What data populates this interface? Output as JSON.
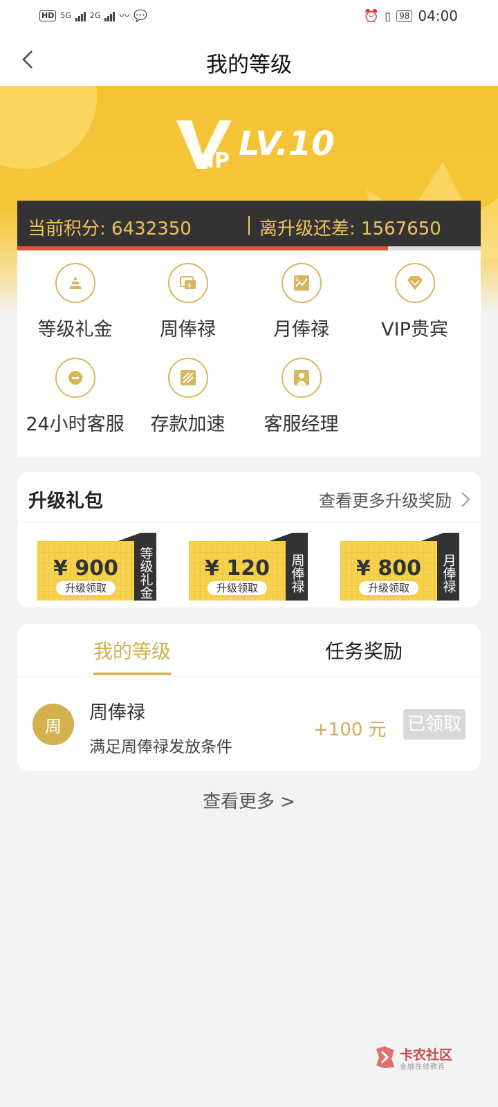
{
  "status_bar": {
    "network_hd": "HD",
    "net1": "5G",
    "net2": "2G",
    "battery": "98",
    "time": "04:00"
  },
  "header": {
    "title": "我的等级"
  },
  "hero": {
    "level": "LV.10",
    "points_label": "当前积分: 6432350",
    "gap_label": "离升级还差: 1567650",
    "progress": 0.8
  },
  "privileges": [
    {
      "label": "等级礼金",
      "icon": "pyramid-icon"
    },
    {
      "label": "周俸禄",
      "icon": "money-card-icon"
    },
    {
      "label": "月俸禄",
      "icon": "chart-money-icon"
    },
    {
      "label": "VIP贵宾",
      "icon": "diamond-icon"
    },
    {
      "label": "24小时客服",
      "icon": "headset-icon"
    },
    {
      "label": "存款加速",
      "icon": "rocket-icon"
    },
    {
      "label": "客服经理",
      "icon": "manager-icon"
    }
  ],
  "gifts": {
    "title": "升级礼包",
    "more": "查看更多升级奖励",
    "items": [
      {
        "amount": "¥ 900",
        "sub": "升级领取",
        "tag": "等级礼金"
      },
      {
        "amount": "¥ 120",
        "sub": "升级领取",
        "tag": "周俸禄"
      },
      {
        "amount": "¥ 800",
        "sub": "升级领取",
        "tag": "月俸禄"
      }
    ]
  },
  "tasks": {
    "tab_mylevel": "我的等级",
    "tab_tasks": "任务奖励",
    "item": {
      "avatar": "周",
      "title": "周俸禄",
      "desc": "满足周俸禄发放条件",
      "reward": "+100 元",
      "status": "已领取"
    }
  },
  "see_more": "查看更多 >",
  "watermark": {
    "name": "卡农社区",
    "sub": "金融在线教育"
  },
  "colors": {
    "gold": "#f4c233",
    "accent": "#d7b65c",
    "dark": "#333333",
    "progress": "#e0523a"
  }
}
